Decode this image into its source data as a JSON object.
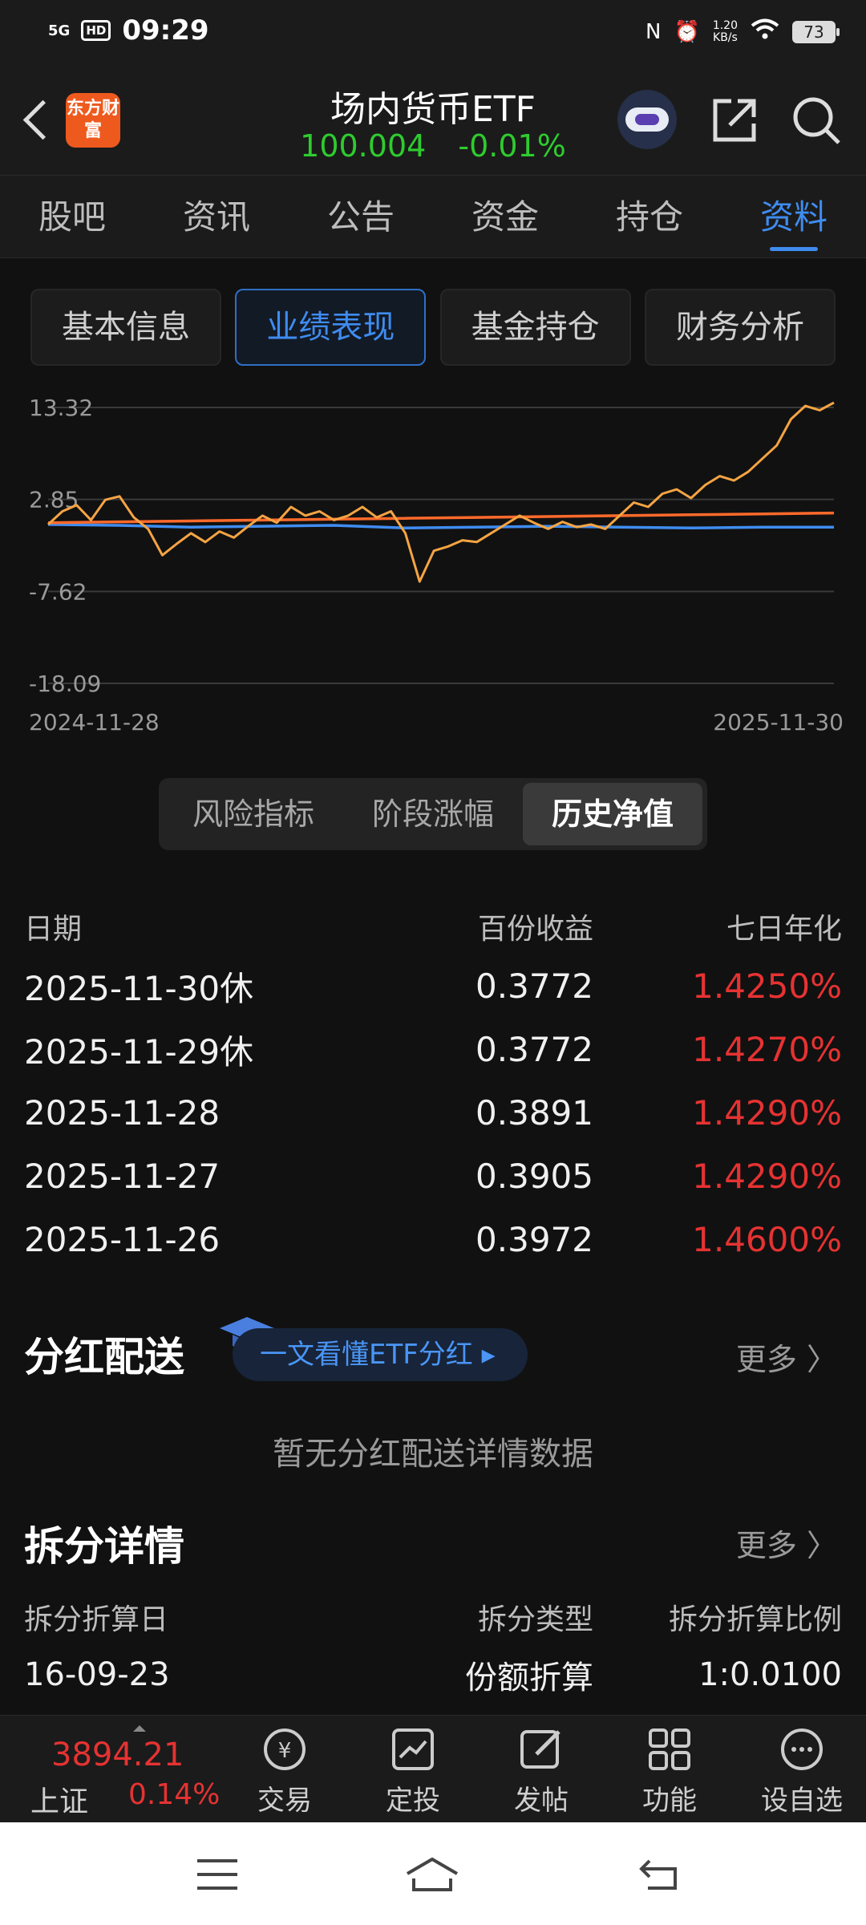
{
  "status_bar": {
    "time": "09:29",
    "signal": "5G",
    "hd": "HD",
    "net_speed": "1.20",
    "net_unit": "KB/s",
    "battery": "73"
  },
  "header": {
    "logo_text": "东方财富",
    "title": "场内货币ETF",
    "price": "100.004",
    "change": "-0.01%"
  },
  "tabs": [
    "股吧",
    "资讯",
    "公告",
    "资金",
    "持仓",
    "资料"
  ],
  "subtabs": [
    "基本信息",
    "业绩表现",
    "基金持仓",
    "财务分析"
  ],
  "chart_data": {
    "type": "line",
    "y_ticks": [
      "13.32",
      "2.85",
      "-7.62",
      "-18.09"
    ],
    "ylim": [
      -18.09,
      13.32
    ],
    "x_ticks": [
      "2024-11-28",
      "2025-11-30"
    ],
    "grid": true,
    "series": [
      {
        "color": "#f5a443",
        "values": [
          0.0,
          1.5,
          2.2,
          0.5,
          2.8,
          3.2,
          0.8,
          -0.5,
          -3.5,
          -2.2,
          -1.0,
          -2.0,
          -0.8,
          -1.5,
          -0.2,
          1.0,
          0.2,
          2.0,
          1.0,
          1.5,
          0.5,
          1.0,
          2.0,
          0.8,
          1.5,
          -1.0,
          -6.5,
          -3.0,
          -2.5,
          -1.8,
          -2.0,
          -1.0,
          0.0,
          1.0,
          0.2,
          -0.5,
          0.3,
          -0.3,
          0.0,
          -0.5,
          1.0,
          2.5,
          2.0,
          3.5,
          4.0,
          3.0,
          4.5,
          5.5,
          5.0,
          6.0,
          7.5,
          9.0,
          12.0,
          13.5,
          13.0,
          14.0
        ]
      },
      {
        "color": "#ff6a2b",
        "values": [
          0.2,
          0.3,
          0.4,
          0.5,
          0.6,
          0.7,
          0.8,
          0.9,
          1.0,
          1.1,
          1.2,
          1.3
        ]
      },
      {
        "color": "#3f8cf0",
        "values": [
          0.0,
          -0.1,
          -0.3,
          -0.2,
          -0.1,
          -0.4,
          -0.3,
          -0.2,
          -0.3,
          -0.4,
          -0.3,
          -0.3
        ]
      }
    ]
  },
  "segment": [
    "风险指标",
    "阶段涨幅",
    "历史净值"
  ],
  "nav_table": {
    "headers": [
      "日期",
      "百份收益",
      "七日年化"
    ],
    "rows": [
      [
        "2025-11-30休",
        "0.3772",
        "1.4250%"
      ],
      [
        "2025-11-29休",
        "0.3772",
        "1.4270%"
      ],
      [
        "2025-11-28",
        "0.3891",
        "1.4290%"
      ],
      [
        "2025-11-27",
        "0.3905",
        "1.4290%"
      ],
      [
        "2025-11-26",
        "0.3972",
        "1.4600%"
      ]
    ]
  },
  "dividend": {
    "title": "分红配送",
    "pill": "一文看懂ETF分红 ▸",
    "more": "更多 〉",
    "empty": "暂无分红配送详情数据"
  },
  "split": {
    "title": "拆分详情",
    "more": "更多 〉",
    "headers": [
      "拆分折算日",
      "拆分类型",
      "拆分折算比例"
    ],
    "rows": [
      [
        "16-09-23",
        "份额折算",
        "1:0.0100"
      ]
    ]
  },
  "bottom_bar": {
    "index_value": "3894.21",
    "index_name": "上证",
    "index_pct": "0.14%",
    "items": [
      {
        "label": "交易",
        "icon": "trade-icon"
      },
      {
        "label": "定投",
        "icon": "invest-plan-icon"
      },
      {
        "label": "发帖",
        "icon": "post-icon"
      },
      {
        "label": "功能",
        "icon": "grid-icon"
      },
      {
        "label": "设自选",
        "icon": "more-icon"
      }
    ]
  },
  "colors": {
    "accent": "#3f8cf0",
    "up": "#e63232",
    "down": "#2ecc2e"
  }
}
